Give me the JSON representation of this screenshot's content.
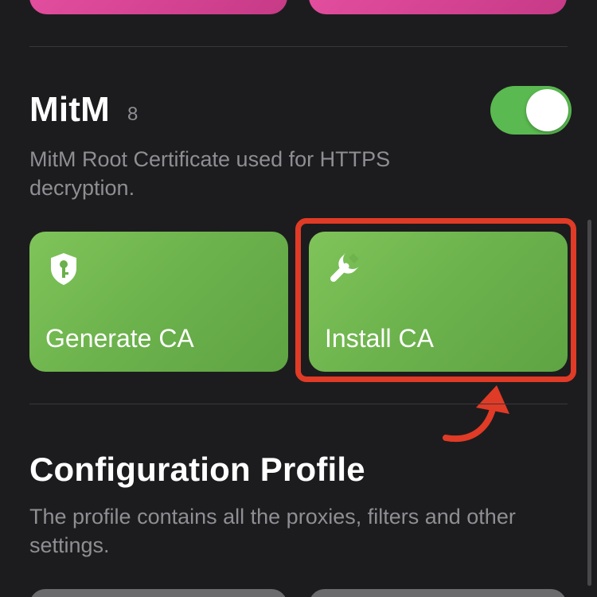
{
  "colors": {
    "background": "#1c1c1e",
    "tile_green": "#6ab04b",
    "tile_pink": "#e54fa0",
    "toggle_on": "#5ab950",
    "highlight_red": "#e03b26",
    "secondary_text": "#8e8e93"
  },
  "mitm": {
    "title": "MitM",
    "count": "8",
    "toggle_on": true,
    "description": "MitM Root Certificate used for HTTPS decryption.",
    "actions": [
      {
        "label": "Generate CA",
        "icon": "shield-key-icon"
      },
      {
        "label": "Install CA",
        "icon": "wrench-icon"
      }
    ]
  },
  "profile": {
    "title": "Configuration Profile",
    "description": "The profile contains all the proxies, filters and other settings."
  },
  "annotation": {
    "highlighted": "Install CA",
    "arrow_icon": "curved-arrow-icon"
  }
}
